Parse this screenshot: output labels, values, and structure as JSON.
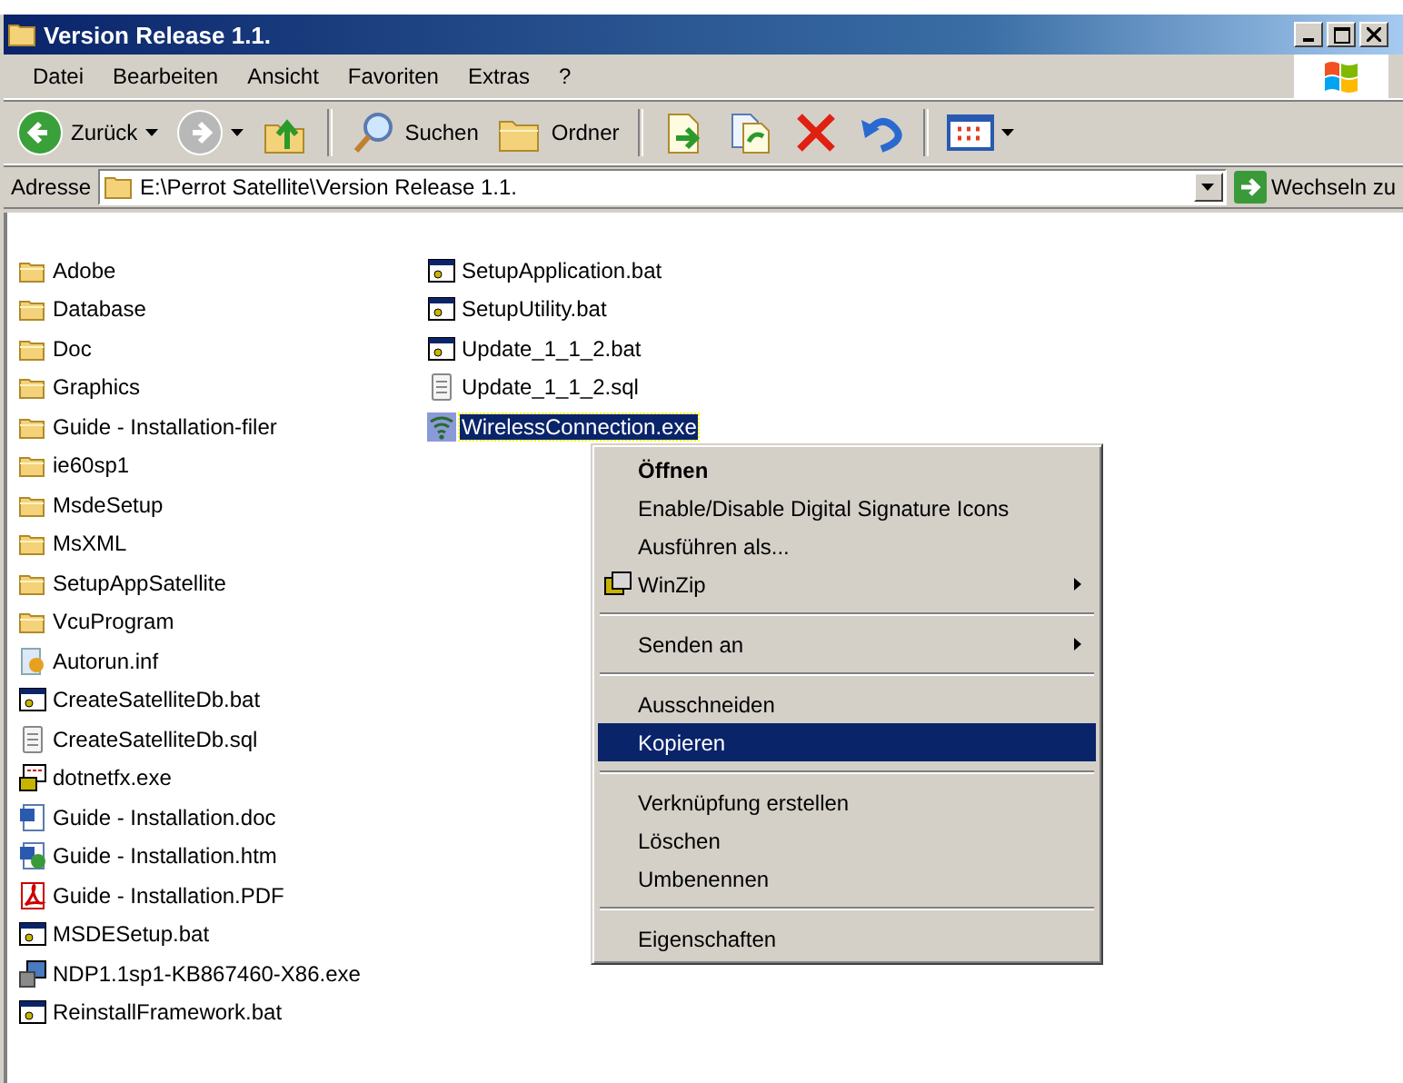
{
  "window": {
    "title": "Version Release 1.1."
  },
  "menu": [
    "Datei",
    "Bearbeiten",
    "Ansicht",
    "Favoriten",
    "Extras",
    "?"
  ],
  "toolbar": [
    {
      "kind": "back",
      "label": "Zurück",
      "disabled": false
    },
    {
      "kind": "forward",
      "disabled": true
    },
    {
      "kind": "up"
    },
    {
      "kind": "search",
      "label": "Suchen"
    },
    {
      "kind": "folders",
      "label": "Ordner"
    },
    {
      "kind": "move"
    },
    {
      "kind": "copy"
    },
    {
      "kind": "delete"
    },
    {
      "kind": "undo"
    },
    {
      "kind": "views"
    }
  ],
  "address": {
    "label": "Adresse",
    "value": "E:\\Perrot Satellite\\Version Release 1.1.",
    "go": "Wechseln zu"
  },
  "files": [
    {
      "name": "Adobe",
      "kind": "folder",
      "selected": false
    },
    {
      "name": "Database",
      "kind": "folder",
      "selected": false
    },
    {
      "name": "Doc",
      "kind": "folder",
      "selected": false
    },
    {
      "name": "Graphics",
      "kind": "folder",
      "selected": false
    },
    {
      "name": "Guide - Installation-filer",
      "kind": "folder",
      "selected": false
    },
    {
      "name": "ie60sp1",
      "kind": "folder",
      "selected": false
    },
    {
      "name": "MsdeSetup",
      "kind": "folder",
      "selected": false
    },
    {
      "name": "MsXML",
      "kind": "folder",
      "selected": false
    },
    {
      "name": "SetupAppSatellite",
      "kind": "folder",
      "selected": false
    },
    {
      "name": "VcuProgram",
      "kind": "folder",
      "selected": false
    },
    {
      "name": "Autorun.inf",
      "kind": "inf",
      "selected": false
    },
    {
      "name": "CreateSatelliteDb.bat",
      "kind": "bat",
      "selected": false
    },
    {
      "name": "CreateSatelliteDb.sql",
      "kind": "text",
      "selected": false
    },
    {
      "name": "dotnetfx.exe",
      "kind": "installer",
      "selected": false
    },
    {
      "name": "Guide - Installation.doc",
      "kind": "doc",
      "selected": false
    },
    {
      "name": "Guide - Installation.htm",
      "kind": "htm",
      "selected": false
    },
    {
      "name": "Guide - Installation.PDF",
      "kind": "pdf",
      "selected": false
    },
    {
      "name": "MSDESetup.bat",
      "kind": "bat",
      "selected": false
    },
    {
      "name": "NDP1.1sp1-KB867460-X86.exe",
      "kind": "setup",
      "selected": false
    },
    {
      "name": "ReinstallFramework.bat",
      "kind": "bat",
      "selected": false
    },
    {
      "name": "SetupApplication.bat",
      "kind": "bat",
      "selected": false
    },
    {
      "name": "SetupUtility.bat",
      "kind": "bat",
      "selected": false
    },
    {
      "name": "Update_1_1_2.bat",
      "kind": "bat",
      "selected": false
    },
    {
      "name": "Update_1_1_2.sql",
      "kind": "text",
      "selected": false
    },
    {
      "name": "WirelessConnection.exe",
      "kind": "wireless",
      "selected": true
    }
  ],
  "context_menu": [
    {
      "kind": "item",
      "label": "Öffnen",
      "default": true,
      "submenu": false,
      "selected": false
    },
    {
      "kind": "item",
      "label": "Enable/Disable Digital Signature Icons",
      "default": false,
      "submenu": false,
      "selected": false
    },
    {
      "kind": "item",
      "label": "Ausführen als...",
      "default": false,
      "submenu": false,
      "selected": false
    },
    {
      "kind": "archiver",
      "label": "WinZip",
      "default": false,
      "submenu": true,
      "selected": false
    },
    {
      "kind": "separator"
    },
    {
      "kind": "item",
      "label": "Senden an",
      "default": false,
      "submenu": true,
      "selected": false
    },
    {
      "kind": "separator"
    },
    {
      "kind": "item",
      "label": "Ausschneiden",
      "default": false,
      "submenu": false,
      "selected": false
    },
    {
      "kind": "item",
      "label": "Kopieren",
      "default": false,
      "submenu": false,
      "selected": true
    },
    {
      "kind": "separator"
    },
    {
      "kind": "item",
      "label": "Verknüpfung erstellen",
      "default": false,
      "submenu": false,
      "selected": false
    },
    {
      "kind": "item",
      "label": "Löschen",
      "default": false,
      "submenu": false,
      "selected": false
    },
    {
      "kind": "item",
      "label": "Umbenennen",
      "default": false,
      "submenu": false,
      "selected": false
    },
    {
      "kind": "separator"
    },
    {
      "kind": "item",
      "label": "Eigenschaften",
      "default": false,
      "submenu": false,
      "selected": false
    }
  ]
}
